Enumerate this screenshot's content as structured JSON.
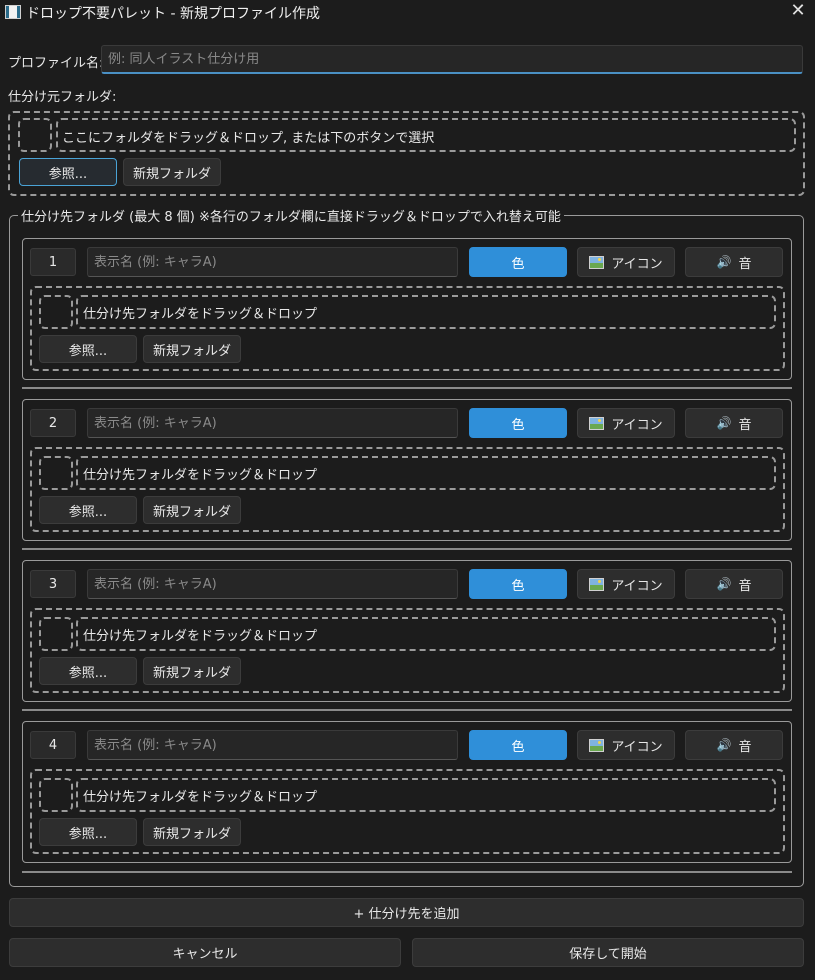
{
  "window": {
    "title": "ドロップ不要パレット - 新規プロファイル作成"
  },
  "profile": {
    "label": "プロファイル名:",
    "placeholder": "例: 同人イラスト仕分け用",
    "value": ""
  },
  "source": {
    "label": "仕分け元フォルダ:",
    "drop_text": "ここにフォルダをドラッグ＆ドロップ, または下のボタンで選択",
    "browse": "参照...",
    "new_folder": "新規フォルダ"
  },
  "destinations": {
    "legend": "仕分け先フォルダ (最大 8 個) ※各行のフォルダ欄に直接ドラッグ＆ドロップで入れ替え可能",
    "rows": [
      {
        "number": "1",
        "name_placeholder": "表示名 (例: キャラA)",
        "color": "色",
        "icon": "アイコン",
        "sound": "音",
        "drop_text": "仕分け先フォルダをドラッグ＆ドロップ",
        "browse": "参照...",
        "new_folder": "新規フォルダ"
      },
      {
        "number": "2",
        "name_placeholder": "表示名 (例: キャラA)",
        "color": "色",
        "icon": "アイコン",
        "sound": "音",
        "drop_text": "仕分け先フォルダをドラッグ＆ドロップ",
        "browse": "参照...",
        "new_folder": "新規フォルダ"
      },
      {
        "number": "3",
        "name_placeholder": "表示名 (例: キャラA)",
        "color": "色",
        "icon": "アイコン",
        "sound": "音",
        "drop_text": "仕分け先フォルダをドラッグ＆ドロップ",
        "browse": "参照...",
        "new_folder": "新規フォルダ"
      },
      {
        "number": "4",
        "name_placeholder": "表示名 (例: キャラA)",
        "color": "色",
        "icon": "アイコン",
        "sound": "音",
        "drop_text": "仕分け先フォルダをドラッグ＆ドロップ",
        "browse": "参照...",
        "new_folder": "新規フォルダ"
      }
    ]
  },
  "footer": {
    "add": "+ 仕分け先を追加",
    "cancel": "キャンセル",
    "save": "保存して開始"
  },
  "colors": {
    "accent": "#2f8fd9",
    "background": "#1c1c1c",
    "border": "#9a9a9a"
  }
}
